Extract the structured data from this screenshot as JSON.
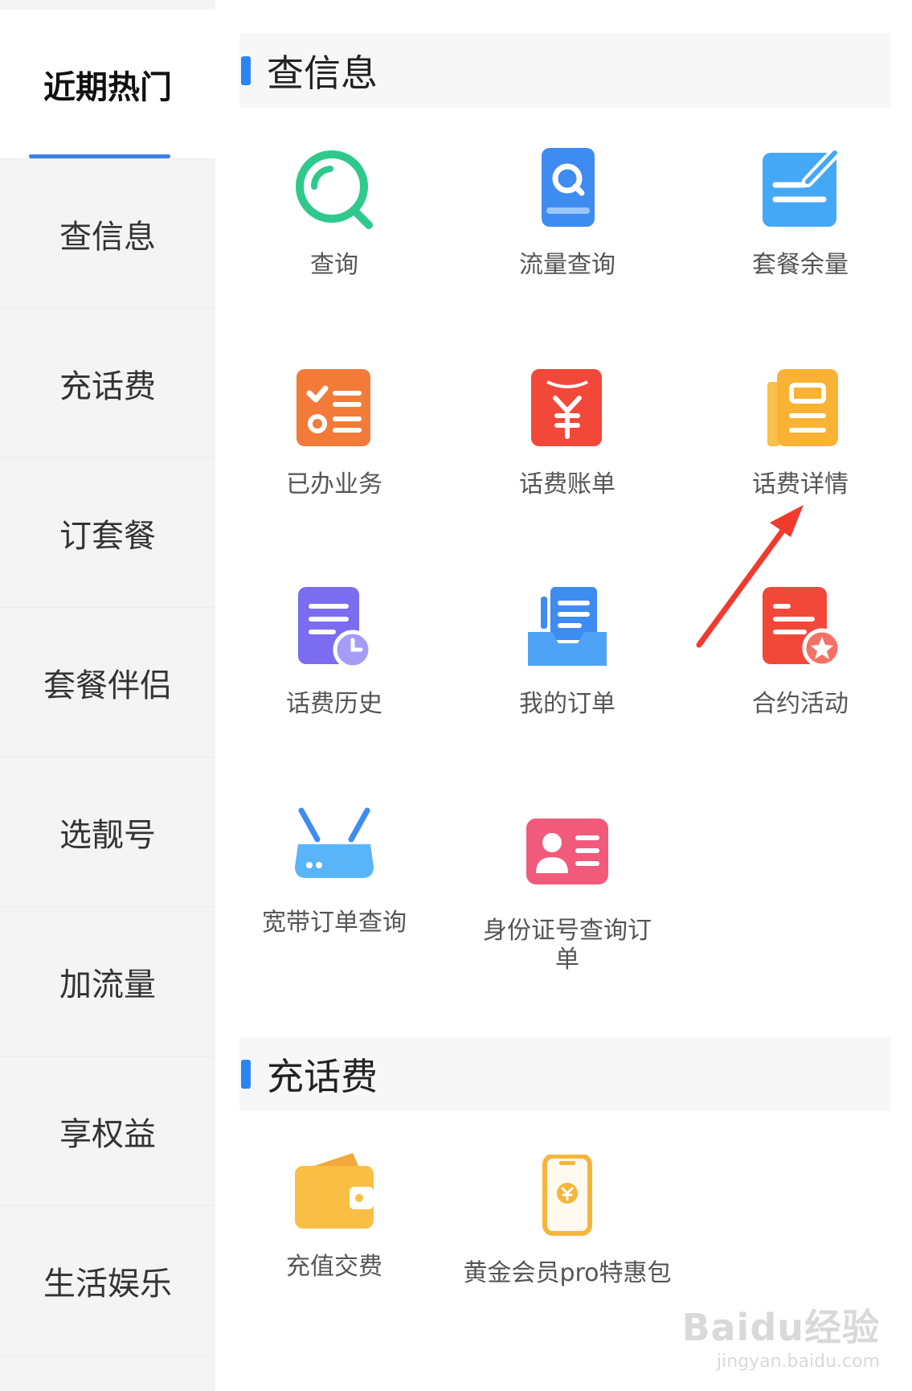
{
  "sidebar": {
    "items": [
      {
        "label": "近期热门",
        "active": true
      },
      {
        "label": "查信息"
      },
      {
        "label": "充话费"
      },
      {
        "label": "订套餐"
      },
      {
        "label": "套餐伴侣"
      },
      {
        "label": "选靓号"
      },
      {
        "label": "加流量"
      },
      {
        "label": "享权益"
      },
      {
        "label": "生活娱乐"
      }
    ]
  },
  "sections": {
    "query": {
      "title": "查信息",
      "items": [
        {
          "label": "查询",
          "icon": "search-circle-icon"
        },
        {
          "label": "流量查询",
          "icon": "data-search-icon"
        },
        {
          "label": "套餐余量",
          "icon": "package-balance-icon"
        },
        {
          "label": "已办业务",
          "icon": "checklist-icon"
        },
        {
          "label": "话费账单",
          "icon": "bill-envelope-icon"
        },
        {
          "label": "话费详情",
          "icon": "bill-detail-icon"
        },
        {
          "label": "话费历史",
          "icon": "bill-history-icon"
        },
        {
          "label": "我的订单",
          "icon": "order-tray-icon"
        },
        {
          "label": "合约活动",
          "icon": "contract-star-icon"
        },
        {
          "label": "宽带订单查询",
          "icon": "router-icon"
        },
        {
          "label": "身份证号查询订单",
          "icon": "id-card-icon"
        }
      ]
    },
    "recharge": {
      "title": "充话费",
      "items": [
        {
          "label": "充值交费",
          "icon": "wallet-icon"
        },
        {
          "label": "黄金会员pro特惠包",
          "icon": "phone-coin-icon"
        }
      ]
    }
  },
  "watermark": {
    "main": "Baidu经验",
    "sub": "jingyan.baidu.com"
  },
  "colors": {
    "accent": "#3d7fe0",
    "arrow": "#f03a2e"
  }
}
